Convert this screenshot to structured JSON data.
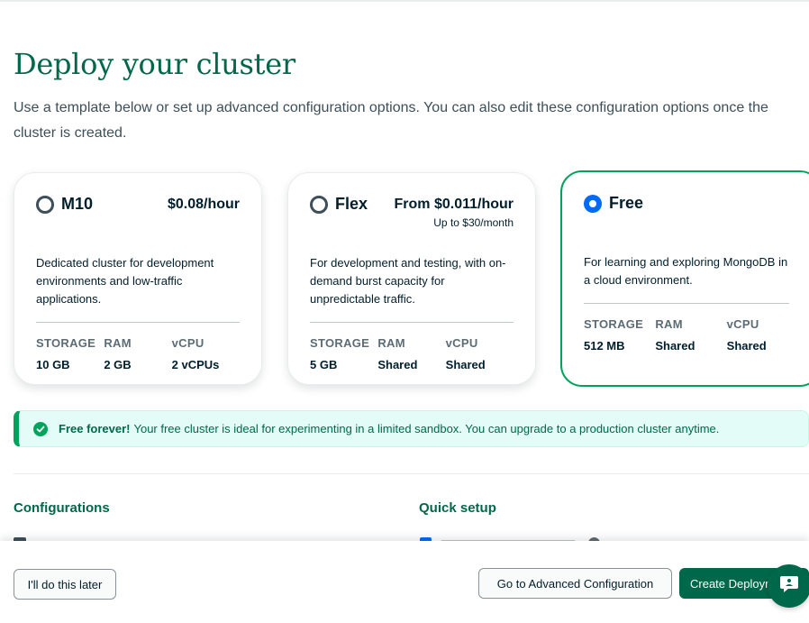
{
  "page": {
    "title": "Deploy your cluster",
    "subtitle": "Use a template below or set up advanced configuration options. You can also edit these configuration options once the cluster is created."
  },
  "tiers": [
    {
      "name": "M10",
      "price": "$0.08/hour",
      "price_sub": "",
      "selected": false,
      "description": "Dedicated cluster for development environments and low-traffic applications.",
      "specs": [
        {
          "label": "STORAGE",
          "value": "10 GB"
        },
        {
          "label": "RAM",
          "value": "2 GB"
        },
        {
          "label": "vCPU",
          "value": "2 vCPUs"
        }
      ]
    },
    {
      "name": "Flex",
      "price": "From $0.011/hour",
      "price_sub": "Up to $30/month",
      "selected": false,
      "description": "For development and testing, with on-demand burst capacity for unpredictable traffic.",
      "specs": [
        {
          "label": "STORAGE",
          "value": "5 GB"
        },
        {
          "label": "RAM",
          "value": "Shared"
        },
        {
          "label": "vCPU",
          "value": "Shared"
        }
      ]
    },
    {
      "name": "Free",
      "price": "",
      "price_sub": "",
      "selected": true,
      "description": "For learning and exploring MongoDB in a cloud environment.",
      "specs": [
        {
          "label": "STORAGE",
          "value": "512 MB"
        },
        {
          "label": "RAM",
          "value": "Shared"
        },
        {
          "label": "vCPU",
          "value": "Shared"
        }
      ]
    }
  ],
  "banner": {
    "strong": "Free forever!",
    "text": "Your free cluster is ideal for experimenting in a limited sandbox. You can upgrade to a production cluster anytime."
  },
  "sections": {
    "configurations": "Configurations",
    "quick_setup": "Quick setup"
  },
  "footer": {
    "later_label": "I'll do this later",
    "advanced_label": "Go to Advanced Configuration",
    "create_label": "Create Deployment"
  },
  "colors": {
    "brand_green": "#00684a",
    "accent_green": "#00a35c",
    "radio_blue": "#016bf8"
  },
  "icons": {
    "banner": "check-circle-icon",
    "chat": "chat-support-icon"
  }
}
